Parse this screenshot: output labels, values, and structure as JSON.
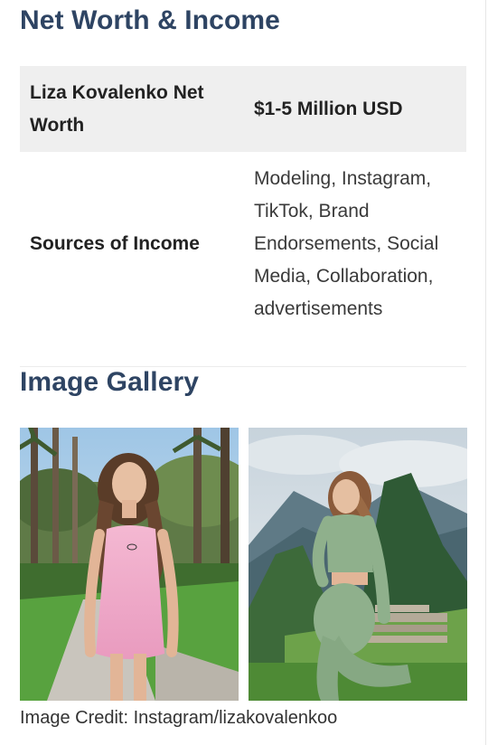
{
  "sections": {
    "net_worth_heading": "Net Worth & Income",
    "gallery_heading": "Image Gallery"
  },
  "table": {
    "rows": [
      {
        "label": "Liza Kovalenko Net Worth",
        "value": "$1-5 Million USD"
      },
      {
        "label": "Sources of Income",
        "value": "Modeling, Instagram, TikTok, Brand Endorsements, Social Media, Collaboration, advertisements"
      }
    ]
  },
  "gallery": {
    "images": [
      {
        "description": "woman-in-pink-dress-street"
      },
      {
        "description": "woman-in-green-outfit-machu-picchu"
      }
    ],
    "credit": "Image Credit: Instagram/lizakovalenkoo"
  },
  "colors": {
    "heading": "#2e4463",
    "table_shade": "#efefef"
  }
}
